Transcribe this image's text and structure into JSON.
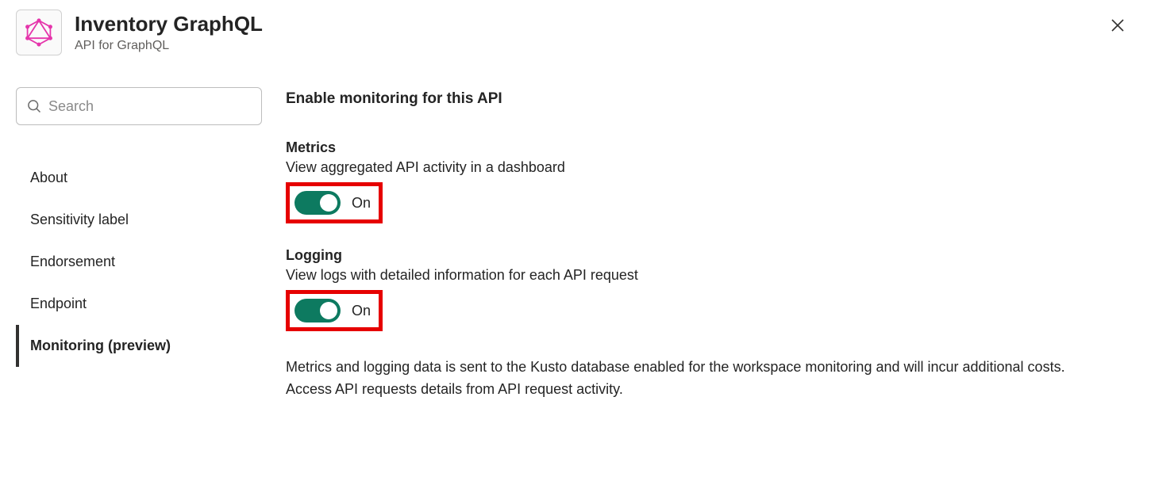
{
  "header": {
    "title": "Inventory GraphQL",
    "subtitle": "API for GraphQL"
  },
  "search": {
    "placeholder": "Search"
  },
  "nav": {
    "items": [
      {
        "label": "About",
        "active": false
      },
      {
        "label": "Sensitivity label",
        "active": false
      },
      {
        "label": "Endorsement",
        "active": false
      },
      {
        "label": "Endpoint",
        "active": false
      },
      {
        "label": "Monitoring (preview)",
        "active": true
      }
    ]
  },
  "main": {
    "heading": "Enable monitoring for this API",
    "metrics": {
      "title": "Metrics",
      "description": "View aggregated API activity in a dashboard",
      "toggle_state": "On",
      "enabled": true
    },
    "logging": {
      "title": "Logging",
      "description": "View logs with detailed information for each API request",
      "toggle_state": "On",
      "enabled": true
    },
    "footnote": "Metrics and logging data is sent to the Kusto database enabled for the workspace monitoring and will incur additional costs. Access API requests details from API request activity."
  },
  "colors": {
    "toggle_on": "#0d7a60",
    "highlight_border": "#e60000",
    "graphql_pink": "#e535ab"
  }
}
